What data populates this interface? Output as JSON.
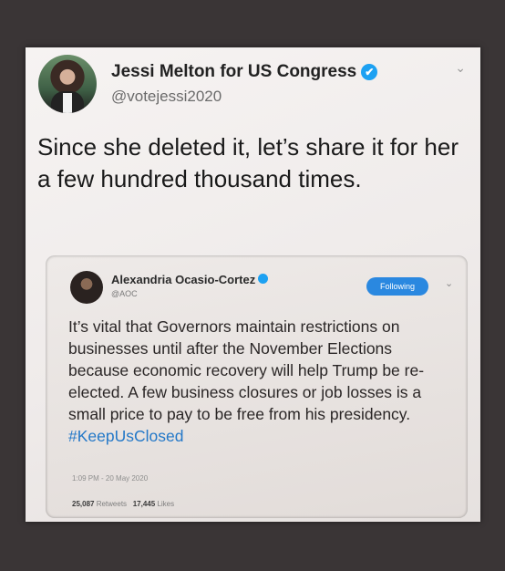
{
  "tweet": {
    "author_name": "Jessi Melton for US Congress",
    "author_handle": "@votejessi2020",
    "verified_icon": "✔",
    "menu_icon": "⌄",
    "text": "Since she deleted it, let’s share it for her a few hundred thousand times."
  },
  "quoted_tweet": {
    "author_name": "Alexandria Ocasio-Cortez",
    "author_handle": "@AOC",
    "follow_label": "Following",
    "menu_icon": "⌄",
    "text": "It’s vital that Governors maintain restrictions on businesses until after the November Elections because economic recovery will help Trump be re-elected. A few business closures or job losses is a small price to pay to be free from his presidency.",
    "hashtag": "#KeepUsClosed",
    "timestamp": "1:09 PM - 20 May 2020",
    "retweets_count": "25,087",
    "retweets_label": "Retweets",
    "likes_count": "17,445",
    "likes_label": "Likes"
  },
  "colors": {
    "background": "#3a3536",
    "verified": "#1da1f2",
    "follow_button": "#2a88e0",
    "hashtag": "#2378c8"
  }
}
